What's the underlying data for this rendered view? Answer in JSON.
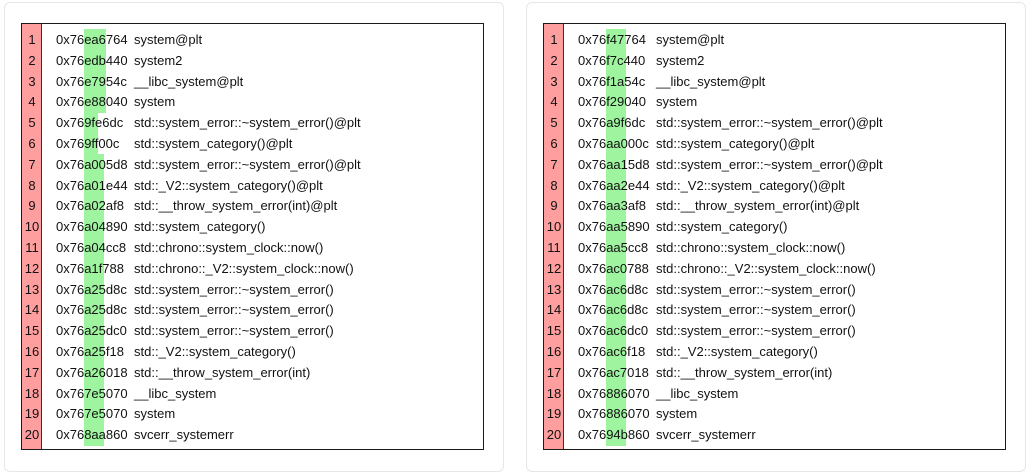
{
  "panels": [
    {
      "name": "left",
      "rows": [
        {
          "n": "1",
          "addr": "0x76ea6764",
          "sym": "system@plt"
        },
        {
          "n": "2",
          "addr": "0x76edb440",
          "sym": "system2"
        },
        {
          "n": "3",
          "addr": "0x76e7954c",
          "sym": "__libc_system@plt"
        },
        {
          "n": "4",
          "addr": "0x76e88040",
          "sym": "system"
        },
        {
          "n": "5",
          "addr": "0x769fe6dc",
          "sym": "std::system_error::~system_error()@plt"
        },
        {
          "n": "6",
          "addr": "0x769ff00c",
          "sym": "std::system_category()@plt"
        },
        {
          "n": "7",
          "addr": "0x76a005d8",
          "sym": "std::system_error::~system_error()@plt"
        },
        {
          "n": "8",
          "addr": "0x76a01e44",
          "sym": "std::_V2::system_category()@plt"
        },
        {
          "n": "9",
          "addr": "0x76a02af8",
          "sym": "std::__throw_system_error(int)@plt"
        },
        {
          "n": "10",
          "addr": "0x76a04890",
          "sym": "std::system_category()"
        },
        {
          "n": "11",
          "addr": "0x76a04cc8",
          "sym": "std::chrono::system_clock::now()"
        },
        {
          "n": "12",
          "addr": "0x76a1f788",
          "sym": "std::chrono::_V2::system_clock::now()"
        },
        {
          "n": "13",
          "addr": "0x76a25d8c",
          "sym": "std::system_error::~system_error()"
        },
        {
          "n": "14",
          "addr": "0x76a25d8c",
          "sym": "std::system_error::~system_error()"
        },
        {
          "n": "15",
          "addr": "0x76a25dc0",
          "sym": "std::system_error::~system_error()"
        },
        {
          "n": "16",
          "addr": "0x76a25f18",
          "sym": "std::_V2::system_category()"
        },
        {
          "n": "17",
          "addr": "0x76a26018",
          "sym": "std::__throw_system_error(int)"
        },
        {
          "n": "18",
          "addr": "0x767e5070",
          "sym": "__libc_system"
        },
        {
          "n": "19",
          "addr": "0x767e5070",
          "sym": "system"
        },
        {
          "n": "20",
          "addr": "0x768aa860",
          "sym": "svcerr_systemerr"
        }
      ]
    },
    {
      "name": "right",
      "rows": [
        {
          "n": "1",
          "addr": "0x76f47764",
          "sym": "system@plt"
        },
        {
          "n": "2",
          "addr": "0x76f7c440",
          "sym": "system2"
        },
        {
          "n": "3",
          "addr": "0x76f1a54c",
          "sym": "__libc_system@plt"
        },
        {
          "n": "4",
          "addr": "0x76f29040",
          "sym": "system"
        },
        {
          "n": "5",
          "addr": "0x76a9f6dc",
          "sym": "std::system_error::~system_error()@plt"
        },
        {
          "n": "6",
          "addr": "0x76aa000c",
          "sym": "std::system_category()@plt"
        },
        {
          "n": "7",
          "addr": "0x76aa15d8",
          "sym": "std::system_error::~system_error()@plt"
        },
        {
          "n": "8",
          "addr": "0x76aa2e44",
          "sym": "std::_V2::system_category()@plt"
        },
        {
          "n": "9",
          "addr": "0x76aa3af8",
          "sym": "std::__throw_system_error(int)@plt"
        },
        {
          "n": "10",
          "addr": "0x76aa5890",
          "sym": "std::system_category()"
        },
        {
          "n": "11",
          "addr": "0x76aa5cc8",
          "sym": "std::chrono::system_clock::now()"
        },
        {
          "n": "12",
          "addr": "0x76ac0788",
          "sym": "std::chrono::_V2::system_clock::now()"
        },
        {
          "n": "13",
          "addr": "0x76ac6d8c",
          "sym": "std::system_error::~system_error()"
        },
        {
          "n": "14",
          "addr": "0x76ac6d8c",
          "sym": "std::system_error::~system_error()"
        },
        {
          "n": "15",
          "addr": "0x76ac6dc0",
          "sym": "std::system_error::~system_error()"
        },
        {
          "n": "16",
          "addr": "0x76ac6f18",
          "sym": "std::_V2::system_category()"
        },
        {
          "n": "17",
          "addr": "0x76ac7018",
          "sym": "std::__throw_system_error(int)"
        },
        {
          "n": "18",
          "addr": "0x76886070",
          "sym": "__libc_system"
        },
        {
          "n": "19",
          "addr": "0x76886070",
          "sym": "system"
        },
        {
          "n": "20",
          "addr": "0x7694b860",
          "sym": "svcerr_systemerr"
        }
      ]
    }
  ],
  "colors": {
    "gutter": "#ff9e9e",
    "highlight": "#9ff59f",
    "border": "#1a1a1a"
  }
}
